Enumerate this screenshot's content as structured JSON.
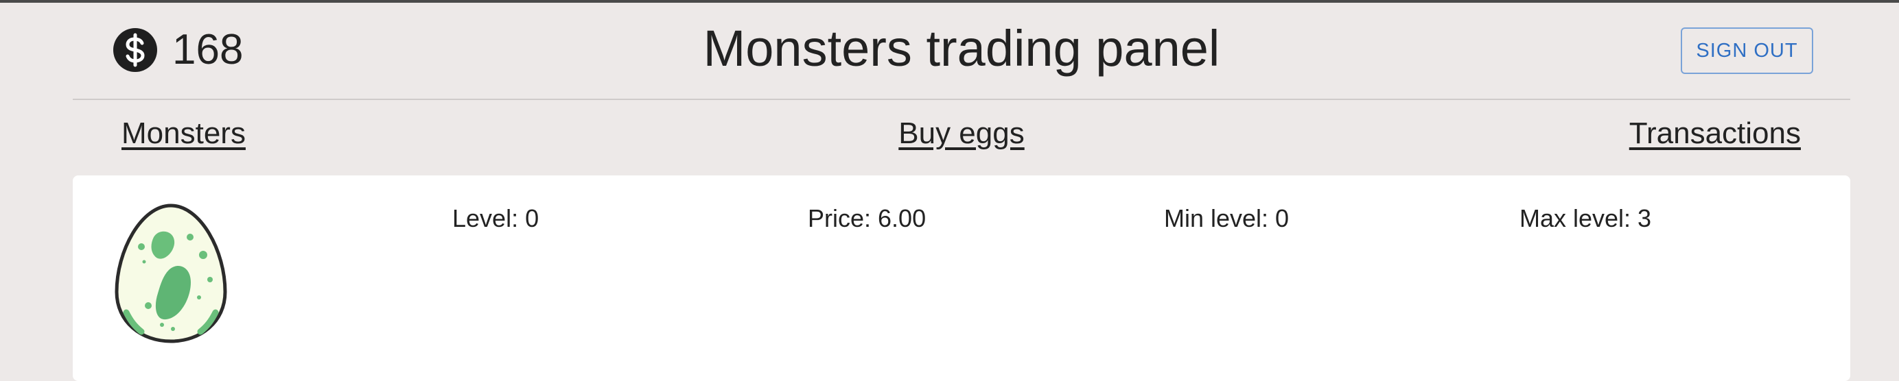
{
  "header": {
    "balance": "168",
    "currency_icon": "dollar-coin-icon",
    "title": "Monsters trading panel",
    "signout_label": "SIGN OUT"
  },
  "nav": {
    "monsters": "Monsters",
    "buy_eggs": "Buy eggs",
    "transactions": "Transactions"
  },
  "egg_card": {
    "image": "egg-icon",
    "level": "Level: 0",
    "price": "Price: 6.00",
    "min_level": "Min level: 0",
    "max_level": "Max level: 3"
  },
  "colors": {
    "background": "#ede9e8",
    "card": "#ffffff",
    "accent": "#2f6fc4",
    "egg_shell": "#f7fbe6",
    "egg_spots": "#5fb574"
  }
}
